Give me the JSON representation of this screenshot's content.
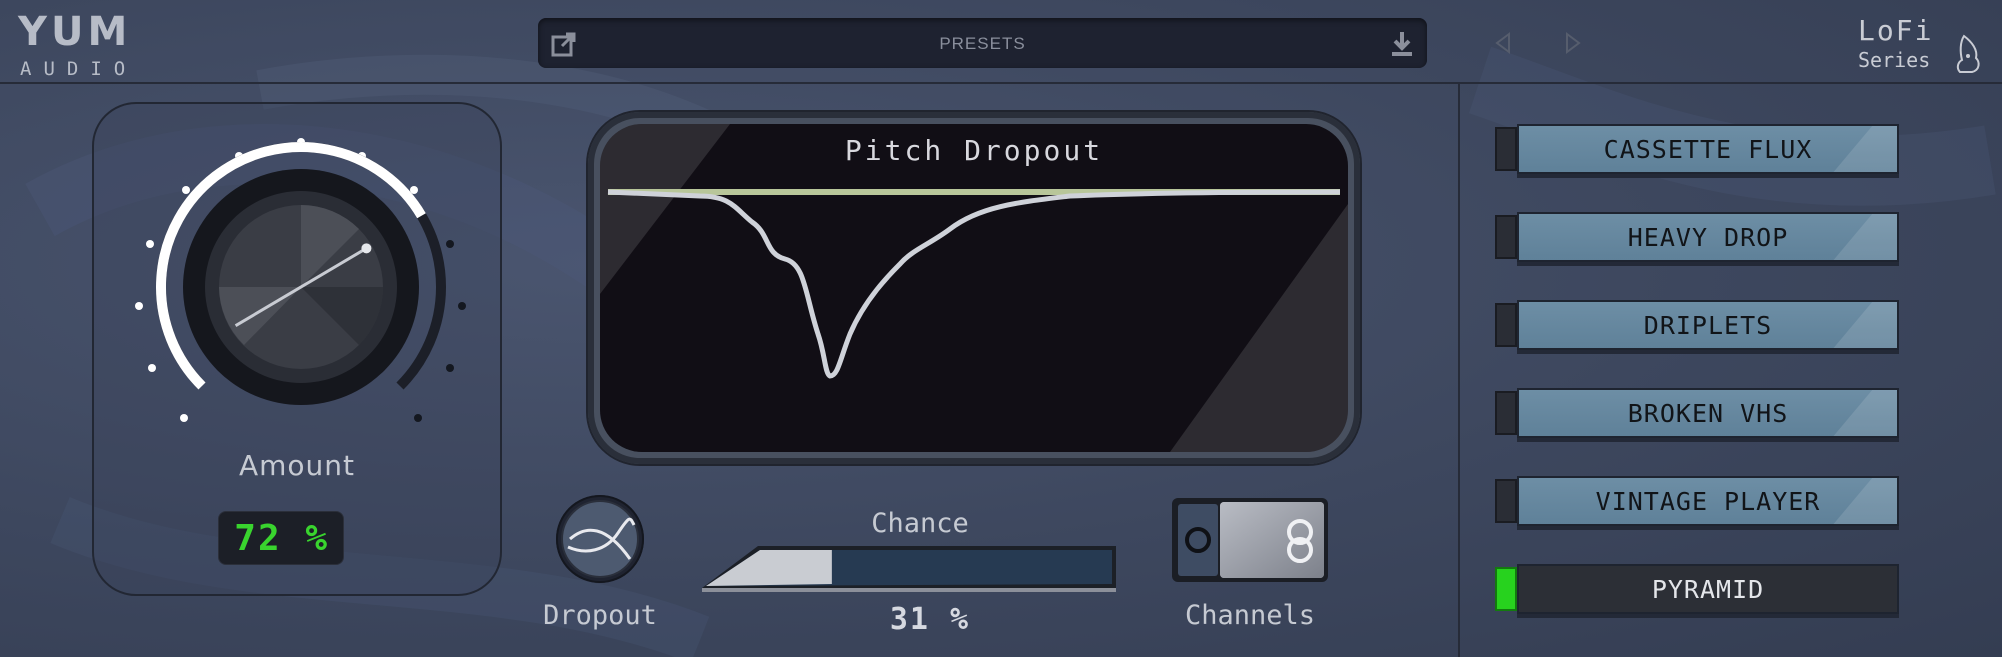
{
  "header": {
    "logo_mark": "YUM",
    "logo_sub": "AUDIO",
    "presets_label": "PRESETS",
    "series_title": "LoFi",
    "series_sub": "Series"
  },
  "amount": {
    "label": "Amount",
    "value_text": "72 %",
    "value": 72
  },
  "screen": {
    "title": "Pitch Dropout"
  },
  "controls": {
    "dropout_label": "Dropout",
    "chance_label": "Chance",
    "chance_value_text": "31 %",
    "chance_value": 31,
    "channels_label": "Channels"
  },
  "presets": [
    {
      "label": "CASSETTE FLUX",
      "active": false
    },
    {
      "label": "HEAVY DROP",
      "active": false
    },
    {
      "label": "DRIPLETS",
      "active": false
    },
    {
      "label": "BROKEN VHS",
      "active": false
    },
    {
      "label": "VINTAGE PLAYER",
      "active": false
    },
    {
      "label": "PYRAMID",
      "active": true
    }
  ],
  "colors": {
    "led_on": "#27d21e",
    "display_green": "#39d42e",
    "preset_blue": "#6d8ea5",
    "curve_line": "#d0d3da",
    "baseline": "#b8c69a"
  }
}
